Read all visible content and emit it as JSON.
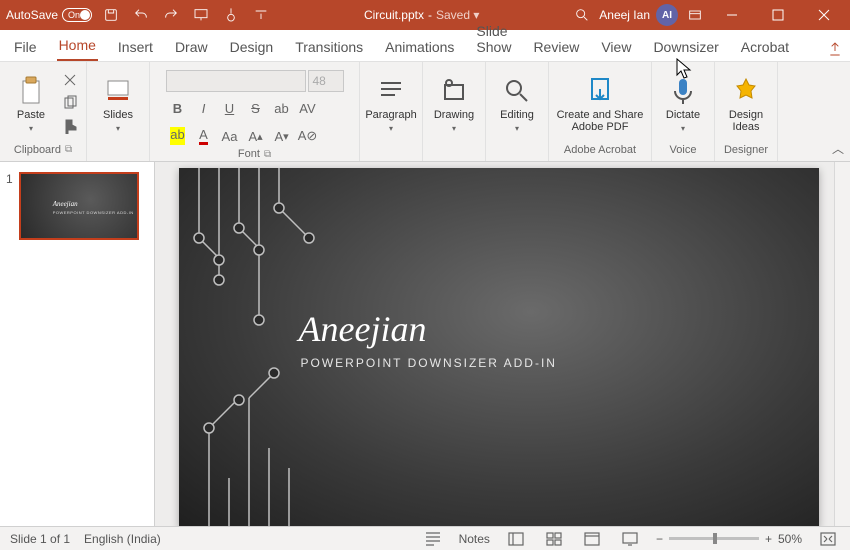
{
  "titlebar": {
    "autosave_label": "AutoSave",
    "autosave_state": "On",
    "doc_name": "Circuit.pptx",
    "doc_divider": "-",
    "saved_state": "Saved ▾",
    "user_name": "Aneej Ian",
    "avatar_initials": "AI"
  },
  "tabs": {
    "items": [
      "File",
      "Home",
      "Insert",
      "Draw",
      "Design",
      "Transitions",
      "Animations",
      "Slide Show",
      "Review",
      "View",
      "Downsizer",
      "Acrobat"
    ],
    "active_index": 1
  },
  "ribbon": {
    "clipboard": {
      "label": "Clipboard",
      "paste": "Paste"
    },
    "slides": {
      "label": "",
      "slides": "Slides"
    },
    "font": {
      "label": "Font",
      "size": "48"
    },
    "paragraph": {
      "label": "",
      "btn": "Paragraph"
    },
    "drawing": {
      "label": "",
      "btn": "Drawing"
    },
    "editing": {
      "label": "",
      "btn": "Editing"
    },
    "acrobat": {
      "label": "Adobe Acrobat",
      "btn": "Create and Share Adobe PDF"
    },
    "voice": {
      "label": "Voice",
      "btn": "Dictate"
    },
    "designer": {
      "label": "Designer",
      "btn": "Design Ideas"
    }
  },
  "thumbs": {
    "items": [
      {
        "num": "1"
      }
    ]
  },
  "slide": {
    "title": "Aneejian",
    "subtitle": "POWERPOINT DOWNSIZER ADD-IN"
  },
  "status": {
    "slide_info": "Slide 1 of 1",
    "language": "English (India)",
    "notes": "Notes",
    "zoom_pct": "50%",
    "minus": "−",
    "plus": "+"
  }
}
